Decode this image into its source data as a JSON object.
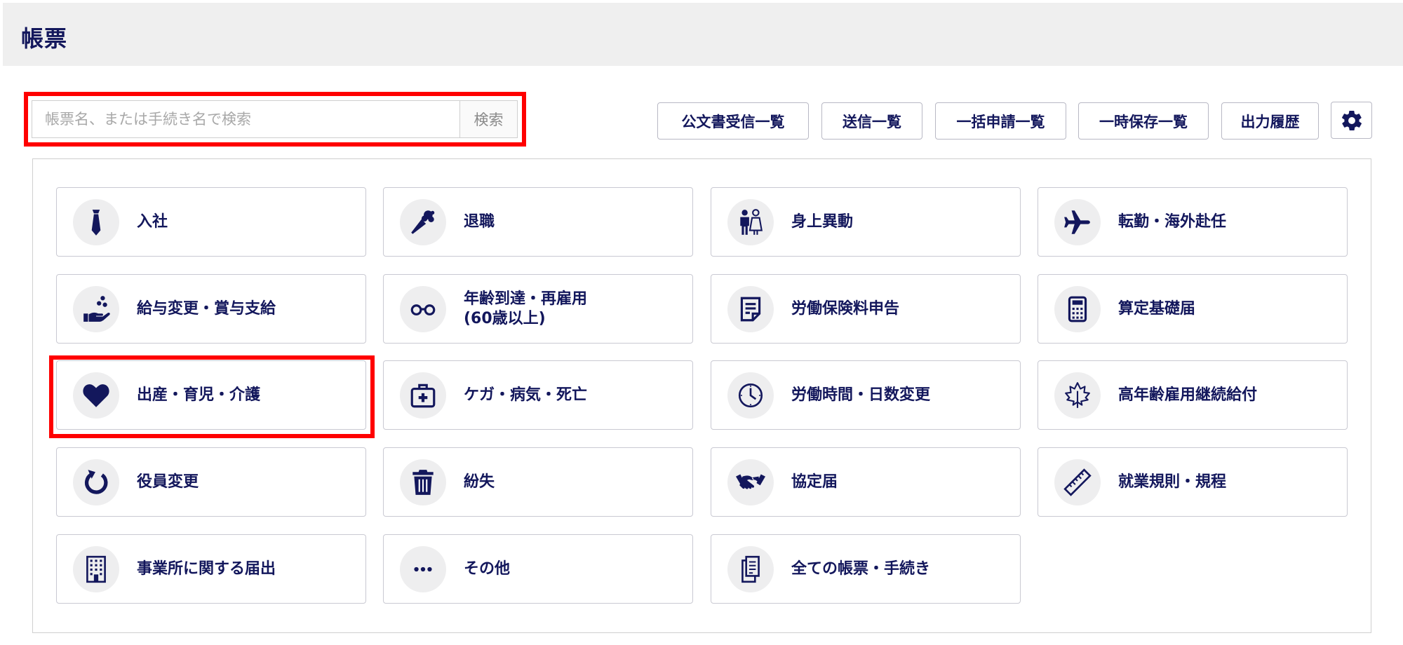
{
  "header": {
    "title": "帳票"
  },
  "search": {
    "placeholder": "帳票名、または手続き名で検索",
    "button_label": "検索"
  },
  "toolbar": {
    "buttons": [
      {
        "label": "公文書受信一覧"
      },
      {
        "label": "送信一覧"
      },
      {
        "label": "一括申請一覧"
      },
      {
        "label": "一時保存一覧"
      },
      {
        "label": "出力履歴"
      }
    ],
    "settings_icon": "gear-icon"
  },
  "categories": [
    {
      "label": "入社",
      "icon": "necktie-icon"
    },
    {
      "label": "退職",
      "icon": "bouquet-icon"
    },
    {
      "label": "身上異動",
      "icon": "wedding-couple-icon"
    },
    {
      "label": "転勤・海外赴任",
      "icon": "airplane-icon"
    },
    {
      "label": "給与変更・賞与支給",
      "icon": "hand-coins-icon"
    },
    {
      "label": "年齢到達・再雇用\n(60歳以上)",
      "icon": "glasses-icon"
    },
    {
      "label": "労働保険料申告",
      "icon": "document-icon"
    },
    {
      "label": "算定基礎届",
      "icon": "calculator-icon"
    },
    {
      "label": "出産・育児・介護",
      "icon": "heart-icon"
    },
    {
      "label": "ケガ・病気・死亡",
      "icon": "first-aid-kit-icon"
    },
    {
      "label": "労働時間・日数変更",
      "icon": "clock-icon"
    },
    {
      "label": "高年齢雇用継続給付",
      "icon": "maple-leaf-icon"
    },
    {
      "label": "役員変更",
      "icon": "refresh-arrow-icon"
    },
    {
      "label": "紛失",
      "icon": "trash-icon"
    },
    {
      "label": "協定届",
      "icon": "handshake-icon"
    },
    {
      "label": "就業規則・規程",
      "icon": "ruler-icon"
    },
    {
      "label": "事業所に関する届出",
      "icon": "building-icon"
    },
    {
      "label": "その他",
      "icon": "ellipsis-icon"
    },
    {
      "label": "全ての帳票・手続き",
      "icon": "documents-icon"
    }
  ],
  "colors": {
    "accent": "#13175c",
    "highlight": "#ff0000",
    "header_bg": "#efefef"
  }
}
